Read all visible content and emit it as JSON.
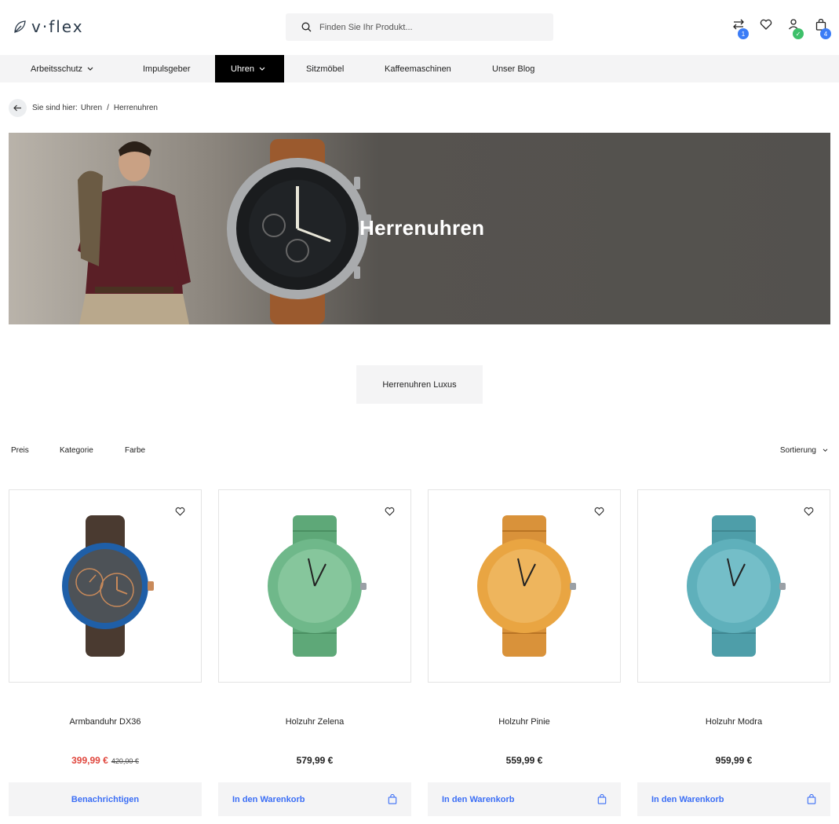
{
  "header": {
    "logo_text": "v·flex",
    "search_placeholder": "Finden Sie Ihr Produkt...",
    "compare_count": "1",
    "cart_count": "4"
  },
  "nav": {
    "items": [
      {
        "label": "Arbeitsschutz",
        "has_dropdown": true
      },
      {
        "label": "Impulsgeber",
        "has_dropdown": false
      },
      {
        "label": "Uhren",
        "has_dropdown": true,
        "active": true
      },
      {
        "label": "Sitzmöbel",
        "has_dropdown": false
      },
      {
        "label": "Kaffeemaschinen",
        "has_dropdown": false
      },
      {
        "label": "Unser Blog",
        "has_dropdown": false
      }
    ]
  },
  "breadcrumb": {
    "prefix": "Sie sind hier:",
    "items": [
      "Uhren",
      "Herrenuhren"
    ]
  },
  "hero": {
    "title": "Herrenuhren"
  },
  "subcategory": "Herrenuhren Luxus",
  "filters": [
    "Preis",
    "Kategorie",
    "Farbe"
  ],
  "sort_label": "Sortierung",
  "products": [
    {
      "name": "Armbanduhr DX36",
      "price": "399,99 €",
      "old_price": "420,00 €",
      "button": "Benachrichtigen",
      "color": "blue-dual"
    },
    {
      "name": "Holzuhr Zelena",
      "price": "579,99 €",
      "button": "In den Warenkorb",
      "color": "#6fb88a"
    },
    {
      "name": "Holzuhr Pinie",
      "price": "559,99 €",
      "button": "In den Warenkorb",
      "color": "#e9a542"
    },
    {
      "name": "Holzuhr Modra",
      "price": "959,99 €",
      "button": "In den Warenkorb",
      "color": "#5fb0bb"
    }
  ],
  "colors": {
    "accent": "#3b6ef5",
    "sale": "#e0473e",
    "badge_blue": "#3b7cf6",
    "badge_green": "#3ec06a"
  }
}
